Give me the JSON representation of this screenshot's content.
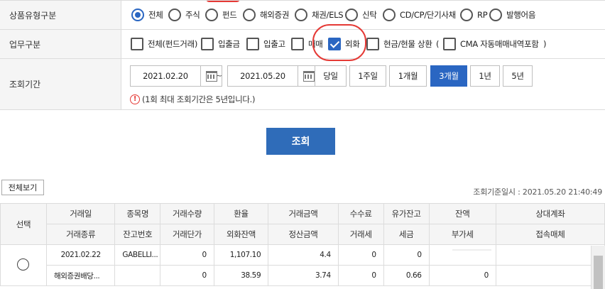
{
  "filter": {
    "product_type": {
      "label": "상품유형구분",
      "options": [
        "전체",
        "주식",
        "펀드",
        "해외증권",
        "채권/ELS",
        "신탁",
        "CD/CP/단기사채",
        "RP",
        "발행어음"
      ],
      "selected": "전체"
    },
    "business_type": {
      "label": "업무구분",
      "options": [
        "전체(펀드거래)",
        "입출금",
        "입출고",
        "매매",
        "외화",
        "현금/현물 상환",
        "CMA 자동매매내역포함"
      ],
      "checked": "외화",
      "paren_open": "(",
      "paren_close": ")"
    },
    "period": {
      "label": "조회기간",
      "start_date": "2021.02.20",
      "end_date": "2021.05.20",
      "separator": "~",
      "buttons": [
        "당일",
        "1주일",
        "1개월",
        "3개월",
        "1년",
        "5년"
      ],
      "selected": "3개월",
      "note_icon": "!",
      "note": "(1회 최대 조회기간은 5년입니다.)"
    }
  },
  "search_button": "조회",
  "view_all_button": "전체보기",
  "base_time": "조회기준일시 : 2021.05.20 21:40:49",
  "table": {
    "select_header": "선택",
    "header_row1": [
      "거래일",
      "종목명",
      "거래수량",
      "환율",
      "거래금액",
      "수수료",
      "유가잔고",
      "잔액",
      "상대계좌"
    ],
    "header_row2": [
      "거래종류",
      "잔고번호",
      "거래단가",
      "외화잔액",
      "정산금액",
      "거래세",
      "세금",
      "부가세",
      "접속매체"
    ],
    "rows": [
      {
        "line1": [
          "2021.02.22",
          "GABELLI...",
          "0",
          "1,107.10",
          "4.4",
          "0",
          "0",
          "",
          ""
        ],
        "line2": [
          "해외증권배당...",
          "",
          "0",
          "38.59",
          "3.74",
          "0",
          "0.66",
          "0",
          ""
        ]
      }
    ]
  },
  "colors": {
    "accent": "#2a66c2",
    "search_button": "#2f6cb9",
    "highlight_ring": "#e53935"
  }
}
